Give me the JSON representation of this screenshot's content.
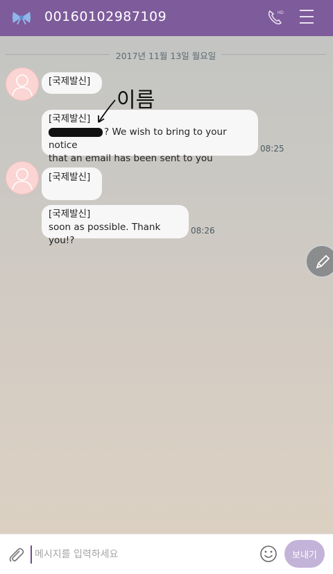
{
  "header": {
    "title": "00160102987109",
    "accent_color": "#7e5b9b",
    "icons": [
      "bow-icon",
      "hd-call-icon",
      "menu-icon"
    ]
  },
  "date_divider": "2017년 11월 13일 월요일",
  "messages": [
    {
      "label": "[국제발신]",
      "text": "",
      "time": ""
    },
    {
      "label": "[국제발신]",
      "text_line1": "? We wish to bring to your notice",
      "text_line2": "that an email has been sent to you",
      "time": "08:25"
    },
    {
      "label": "[국제발신]",
      "text": "",
      "time": ""
    },
    {
      "label": "[국제발신]",
      "text": " soon as possible. Thank you!?",
      "time": "08:26"
    }
  ],
  "annotation": {
    "handwritten_text": "이름"
  },
  "input_bar": {
    "placeholder": "메시지를 입력하세요",
    "send_label": "보내기",
    "send_color": "#c4b3d8"
  }
}
